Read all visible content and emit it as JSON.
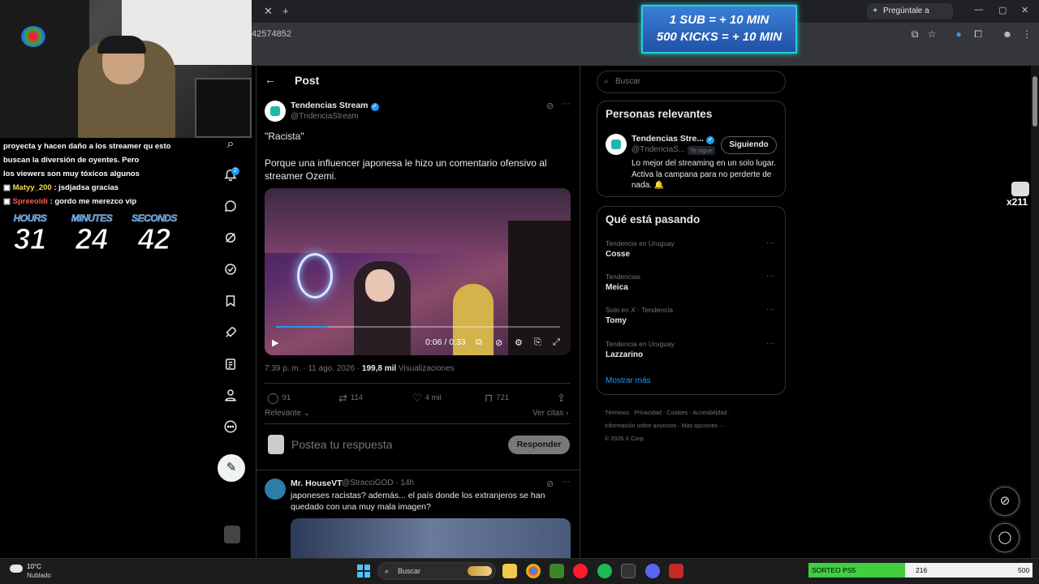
{
  "browser": {
    "url_fragment": "42574852",
    "gemini_label": "Pregúntale a Gemini",
    "new_tab": "+",
    "close_tab": "✕"
  },
  "overlay": {
    "sub_line": "1 SUB = + 10 MIN",
    "kicks_line": "500 KICKS = + 10 MIN"
  },
  "chat": {
    "messages": [
      {
        "text": "proyecta y hacen daño a los streamer qu esto"
      },
      {
        "text": "buscan la diversión de       oyentes. Pero"
      },
      {
        "text": "los viewers son muy tóxicos algunos"
      },
      {
        "user": "Matyy_200",
        "text": ": jsdjadsa gracias"
      },
      {
        "user": "Spreeoldi",
        "text": ": gordo me merezco vip"
      }
    ]
  },
  "timer": {
    "hours_label": "HOURS",
    "hours": "31",
    "minutes_label": "MINUTES",
    "minutes": "24",
    "seconds_label": "SECONDS",
    "seconds": "42"
  },
  "nav": {
    "notification_count": "2",
    "icons": [
      "search-icon",
      "bell-icon",
      "chat-icon",
      "grok-icon",
      "verified-check-icon",
      "bookmark-icon",
      "rocket-icon",
      "list-icon",
      "profile-icon",
      "more-icon"
    ]
  },
  "post": {
    "header": "Post",
    "author_name": "Tendencias Stream",
    "author_handle": "@TndenciaStream",
    "line1": "\"Racista\"",
    "line2": "Porque una influencer japonesa le hizo un comentario ofensivo al streamer Ozemi.",
    "video_time": "0:06 / 0:33",
    "video_progress": 0.18,
    "meta_time": "7:39 p. m. · 11 ago. 2026 · ",
    "meta_views": "199,8 mil",
    "meta_views_label": " Visualizaciones",
    "replies": "91",
    "reposts": "114",
    "likes": "4 mil",
    "bookmarks": "721",
    "sort_label": "Relevante",
    "quotes_label": "Ver citas",
    "reply_placeholder": "Postea tu respuesta",
    "reply_button": "Responder"
  },
  "reply": {
    "name": "Mr. HouseVT",
    "handle": "@StracciGOD · 14h",
    "text": "japoneses racistas? además... el país donde los extranjeros se han quedado con una muy mala imagen?"
  },
  "sidebar": {
    "search_placeholder": "Buscar",
    "relevant_title": "Personas relevantes",
    "relevant_name": "Tendencias Stre...",
    "relevant_handle": "@TndenciaS...",
    "follows_you": "Te sigue",
    "follow_button": "Siguiendo",
    "relevant_bio": "Lo mejor del streaming en un solo lugar. Activa la campana para no perderte de nada. 🔔",
    "trending_title": "Qué está pasando",
    "trends": [
      {
        "context": "Tendencia en Uruguay",
        "name": "Cosse"
      },
      {
        "context": "Tendencias",
        "name": "Meica"
      },
      {
        "context": "Solo en X · Tendencia",
        "name": "Tomy"
      },
      {
        "context": "Tendencia en Uruguay",
        "name": "Lazzarino"
      }
    ],
    "show_more": "Mostrar más",
    "footer_line1": "Términos  ·  Privacidad  ·  Cookies  ·  Accesibilidad  ·",
    "footer_line2": "Información sobre anuncios  ·  Más opciones ···",
    "footer_line3": "© 2026 X Corp."
  },
  "floating": {
    "badge_count": "x211"
  },
  "taskbar": {
    "temp": "10°C",
    "weather": "Nublado",
    "search": "Buscar"
  },
  "sorteo": {
    "label": "SORTEO PS5",
    "current": "216",
    "max": "500",
    "fraction": 0.432
  },
  "colors": {
    "accent": "#1d9bf0",
    "background": "#000000",
    "border": "#2f3336"
  }
}
